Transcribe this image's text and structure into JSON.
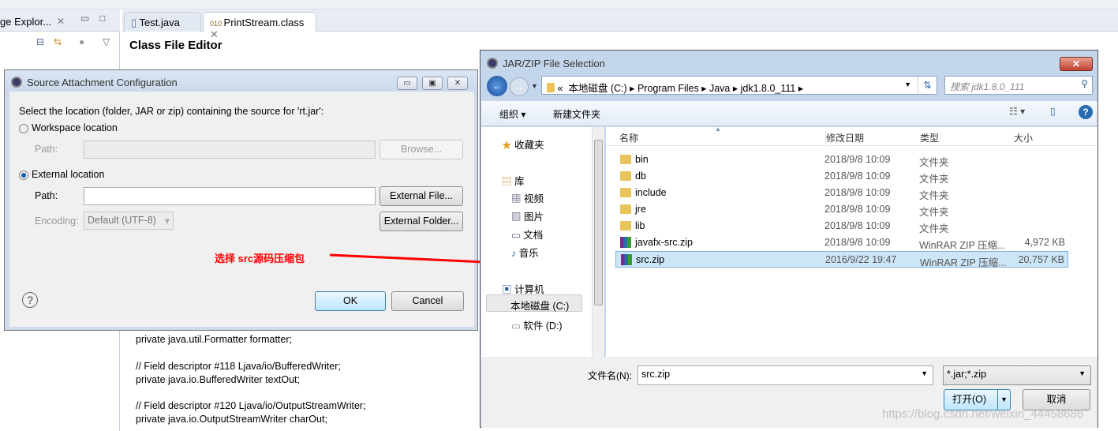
{
  "ide": {
    "left_tab": "ge Explor...",
    "editor_tabs": [
      {
        "label": "Test.java"
      },
      {
        "label": "PrintStream.class"
      }
    ],
    "editor_title": "Class File Editor",
    "code": [
      "private java.util.Formatter formatter;",
      "// Field descriptor #118 Ljava/io/BufferedWriter;",
      "private java.io.BufferedWriter textOut;",
      "// Field descriptor #120 Ljava/io/OutputStreamWriter;",
      "private java.io.OutputStreamWriter charOut;"
    ]
  },
  "source_dialog": {
    "title": "Source Attachment Configuration",
    "prompt": "Select the location (folder, JAR or zip) containing the source for 'rt.jar':",
    "workspace_label": "Workspace location",
    "path_label": "Path:",
    "browse": "Browse...",
    "external_label": "External location",
    "external_path_value": "",
    "external_file": "External File...",
    "encoding_label": "Encoding:",
    "encoding_value": "Default (UTF-8)",
    "external_folder": "External Folder...",
    "ok": "OK",
    "cancel": "Cancel",
    "selected_option": "External location"
  },
  "annotation": {
    "text": "选择 src源码压缩包",
    "color": "#ff0000"
  },
  "file_dialog": {
    "title": "JAR/ZIP File Selection",
    "breadcrumb": [
      "«",
      "本地磁盘 (C:)",
      "Program Files",
      "Java",
      "jdk1.8.0_111"
    ],
    "search_placeholder": "搜索 jdk1.8.0_111",
    "organize": "组织 ▾",
    "new_folder": "新建文件夹",
    "nav": {
      "favorites": "收藏夹",
      "libraries": "库",
      "lib_items": [
        "视频",
        "图片",
        "文档",
        "音乐"
      ],
      "computer": "计算机",
      "drives": [
        "本地磁盘 (C:)",
        "软件 (D:)"
      ]
    },
    "columns": [
      "名称",
      "修改日期",
      "类型",
      "大小"
    ],
    "files": [
      {
        "name": "bin",
        "date": "2018/9/8 10:09",
        "type": "文件夹",
        "size": "",
        "kind": "folder"
      },
      {
        "name": "db",
        "date": "2018/9/8 10:09",
        "type": "文件夹",
        "size": "",
        "kind": "folder"
      },
      {
        "name": "include",
        "date": "2018/9/8 10:09",
        "type": "文件夹",
        "size": "",
        "kind": "folder"
      },
      {
        "name": "jre",
        "date": "2018/9/8 10:09",
        "type": "文件夹",
        "size": "",
        "kind": "folder"
      },
      {
        "name": "lib",
        "date": "2018/9/8 10:09",
        "type": "文件夹",
        "size": "",
        "kind": "folder"
      },
      {
        "name": "javafx-src.zip",
        "date": "2018/9/8 10:09",
        "type": "WinRAR ZIP 压缩...",
        "size": "4,972 KB",
        "kind": "zip"
      },
      {
        "name": "src.zip",
        "date": "2016/9/22 19:47",
        "type": "WinRAR ZIP 压缩...",
        "size": "20,757 KB",
        "kind": "zip",
        "selected": true
      }
    ],
    "filename_label": "文件名(N):",
    "filename_value": "src.zip",
    "filter_value": "*.jar;*.zip",
    "open": "打开(O)",
    "cancel": "取消"
  },
  "watermark": "https://blog.csdn.net/weixin_44458686"
}
